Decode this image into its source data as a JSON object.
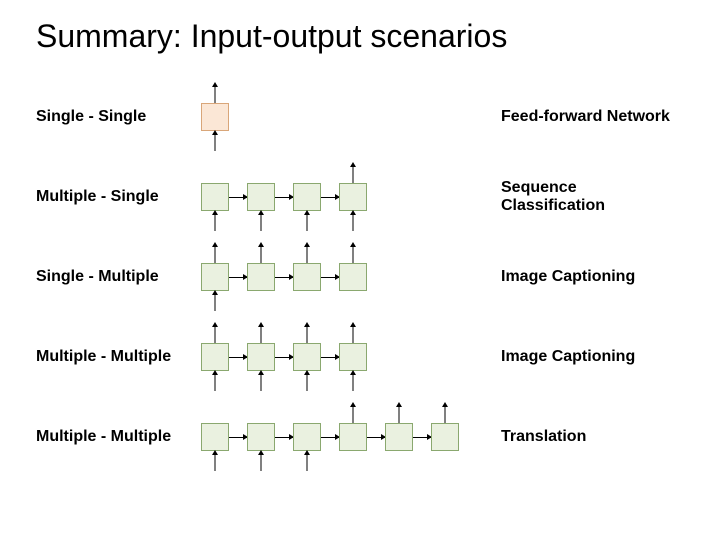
{
  "title": "Summary: Input-output scenarios",
  "rows": [
    {
      "left": "Single - Single",
      "right": "Feed-forward Network"
    },
    {
      "left": "Multiple - Single",
      "right": "Sequence Classification"
    },
    {
      "left": "Single - Multiple",
      "right": "Image Captioning"
    },
    {
      "left": "Multiple - Multiple",
      "right": "Image Captioning"
    },
    {
      "left": "Multiple - Multiple",
      "right": "Translation"
    }
  ]
}
